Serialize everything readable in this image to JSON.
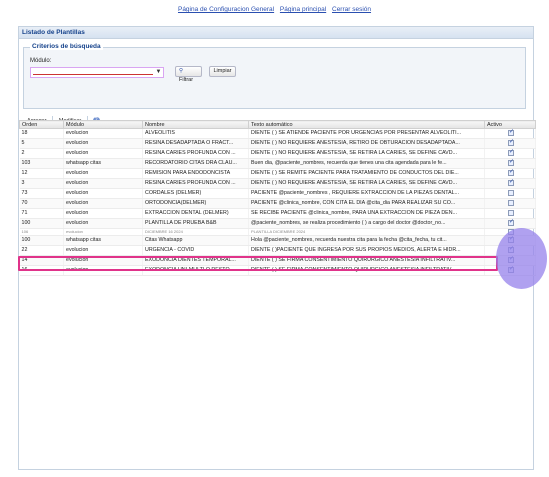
{
  "top_links": [
    {
      "label": "Página de Configuracion General"
    },
    {
      "label": "Página principal"
    },
    {
      "label": "Cerrar sesión"
    }
  ],
  "panel": {
    "title": "Listado de Plantillas"
  },
  "criteria": {
    "legend": "Criterios de búsqueda",
    "modulo_label": "Módulo:",
    "modulo_value": "",
    "filter_label": "Filtrar",
    "clear_label": "Limpiar"
  },
  "toolbar": {
    "add_label": "Agregar",
    "edit_label": "Modificar"
  },
  "grid": {
    "columns": [
      "Orden",
      "Módulo",
      "Nombre",
      "Texto automático",
      "Activo"
    ],
    "rows": [
      {
        "orden": "18",
        "modulo": "evolucion",
        "nombre": "ALVEOLITIS",
        "texto": "DIENTE ( ) SE ATIENDE PACIENTE POR URGENCIAS POR PRESENTAR ALVEOLITI...",
        "activo": true
      },
      {
        "orden": "5",
        "modulo": "evolucion",
        "nombre": "RESINA DESADAPTADA O FRACT...",
        "texto": "DIENTE ( ) NO REQUIERE ANESTESIA, RETIRO DE OBTURACION DESADAPTADA...",
        "activo": true
      },
      {
        "orden": "2",
        "modulo": "evolucion",
        "nombre": "RESINA CARIES PROFUNDA CON ...",
        "texto": "DIENTE ( ) NO REQUIERE ANESTESIA, SE RETIRA LA CARIES, SE DEFINE CAVD...",
        "activo": true
      },
      {
        "orden": "103",
        "modulo": "whatsapp citas",
        "nombre": "RECORDATORIO CITAS DRA CLAU...",
        "texto": "Buen dia, @paciente_nombres, recuerda que tienes una cita agendada para le fe...",
        "activo": true
      },
      {
        "orden": "12",
        "modulo": "evolucion",
        "nombre": "REMISION PARA ENDODONCISTA",
        "texto": "DIENTE ( ) SE REMITE PACIENTE PARA TRATAMIENTO DE CONDUCTOS DEL DIE...",
        "activo": true
      },
      {
        "orden": "3",
        "modulo": "evolucion",
        "nombre": "RESINA CARIES PROFUNDA CON ...",
        "texto": "DIENTE ( ) NO REQUIERE ANESTESIA, SE RETIRA LA CARIES, SE DEFINE CAVD...",
        "activo": true
      },
      {
        "orden": "73",
        "modulo": "evolucion",
        "nombre": "CORDALES (DELMER)",
        "texto": "PACIENTE @paciente_nombres , REQUIERE EXTRACCION DE LA PIEZAS DENTAL...",
        "activo": false
      },
      {
        "orden": "70",
        "modulo": "evolucion",
        "nombre": "ORTODONCIA(DELMER)",
        "texto": "PACIENTE @clinica_nombre, CON CITA EL DIA @cita_dia PARA REALIZAR SU CO...",
        "activo": false
      },
      {
        "orden": "71",
        "modulo": "evolucion",
        "nombre": "EXTRACCION DENTAL (DELMER)",
        "texto": "SE RECIBE PACIENTE @clinica_nombre, PARA UNA EXTRACCION DE PIEZA DEN...",
        "activo": false
      },
      {
        "orden": "100",
        "modulo": "evolucion",
        "nombre": "PLANTILLA DE PRUEBA B&B",
        "texto": "@paciente_nombres, se realiza procedimiento ( ) a cargo del doctor @doctor_no...",
        "activo": true
      },
      {
        "orden": "106",
        "modulo": "evolucion",
        "nombre": "DICIEMBRE 16 2024",
        "texto": "PLANTILLA DICIEMBRE 2024",
        "activo": false,
        "partial": true
      },
      {
        "orden": "100",
        "modulo": "whatsapp citas",
        "nombre": "Citas Whatsapp",
        "texto": "Hola @paciente_nombres, recuerda nuestra cita para la fecha @cita_fecha, tu cit...",
        "activo": true
      },
      {
        "orden": "22",
        "modulo": "evolucion",
        "nombre": "URGENCIA - COVID",
        "texto": "DIENTE ( )PACIENTE QUE INGRESA POR SUS PROPIOS MEDIOS, ALERTA E HIDR...",
        "activo": true
      },
      {
        "orden": "14",
        "modulo": "evolucion",
        "nombre": "EXODONCIA DIENTES TEMPORAL...",
        "texto": "DIENTE ( ) SE FIRMA CONSENTIMIENTO QUIRURGICO ANESTESIA INFILTRATIV...",
        "activo": true
      },
      {
        "orden": "16",
        "modulo": "evolucion",
        "nombre": "EXODONCIA UNI-MULTI O RESTO...",
        "texto": "DIENTE ( ) SE FIRMA CONSENTIMIENTO QUIRURGICO ANESTESIA INFILTRATIV...",
        "activo": true
      }
    ]
  },
  "colors": {
    "highlight": "#e0338a",
    "cursor": "#9682eb",
    "link": "#2a4fb0",
    "header_text": "#15428b"
  }
}
